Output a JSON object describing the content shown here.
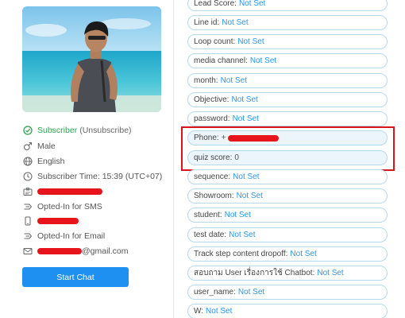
{
  "profile": {
    "status_label": "Subscriber",
    "unsubscribe_label": "(Unsubscribe)",
    "gender": "Male",
    "language": "English",
    "subscriber_time": "Subscriber Time: 15:39 (UTC+07)",
    "sms_optin": "Opted-In for SMS",
    "email_optin": "Opted-In for Email",
    "email_suffix": "@gmail.com"
  },
  "actions": {
    "start_chat": "Start Chat"
  },
  "fields": [
    {
      "label": "Lead Score:",
      "value": "Not Set"
    },
    {
      "label": "Line id:",
      "value": "Not Set"
    },
    {
      "label": "Loop count:",
      "value": "Not Set"
    },
    {
      "label": "media channel:",
      "value": "Not Set"
    },
    {
      "label": "month:",
      "value": "Not Set"
    },
    {
      "label": "Objective:",
      "value": "Not Set"
    },
    {
      "label": "password:",
      "value": "Not Set"
    },
    {
      "label": "Phone:",
      "value": "+"
    },
    {
      "label": "quiz score:",
      "value": "0"
    },
    {
      "label": "sequence:",
      "value": "Not Set"
    },
    {
      "label": "Showroom:",
      "value": "Not Set"
    },
    {
      "label": "student:",
      "value": "Not Set"
    },
    {
      "label": "test date:",
      "value": "Not Set"
    },
    {
      "label": "Track step content dropoff:",
      "value": "Not Set"
    },
    {
      "label": "สอบถาม User เรื่องการใช้ Chatbot:",
      "value": "Not Set"
    },
    {
      "label": "user_name:",
      "value": "Not Set"
    },
    {
      "label": "W:",
      "value": "Not Set"
    }
  ],
  "colors": {
    "accent": "#1e90f2",
    "subscriber_green": "#2ea44f",
    "redaction": "#e8141b",
    "field_border": "#b5d9ea",
    "value_blue": "#2a95e8",
    "highlight_border": "#d9141c"
  },
  "icons": {
    "status": "check-circle-icon",
    "gender": "male-icon",
    "language": "globe-icon",
    "time": "clock-icon",
    "id_card": "id-card-icon",
    "sms_optin": "opt-in-icon",
    "phone": "mobile-phone-icon",
    "email_optin": "opt-in-icon",
    "email": "envelope-icon"
  }
}
